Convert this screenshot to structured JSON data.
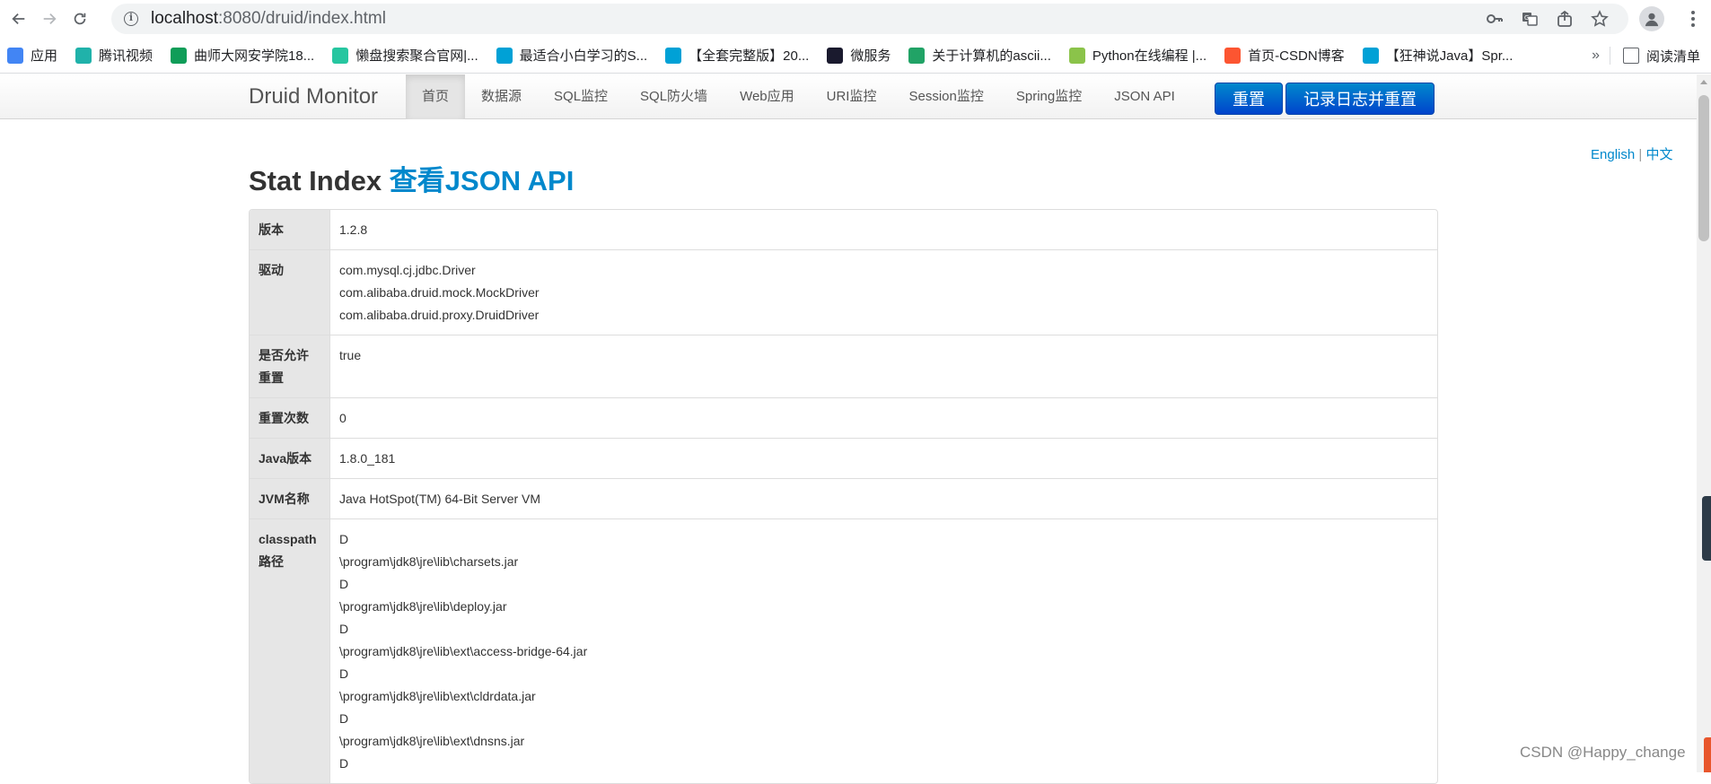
{
  "browser": {
    "url_host": "localhost",
    "url_path": ":8080/druid/index.html"
  },
  "bookmarks": [
    {
      "label": "应用",
      "icon": "apps-grid-icon",
      "color": "#4285f4"
    },
    {
      "label": "腾讯视频",
      "icon": "tencent-video-icon",
      "color": "#20b2aa"
    },
    {
      "label": "曲师大网安学院18...",
      "icon": "sheet-icon",
      "color": "#0f9d58"
    },
    {
      "label": "懒盘搜索聚合官网|...",
      "icon": "gear-green-icon",
      "color": "#26c6a0"
    },
    {
      "label": "最适合小白学习的S...",
      "icon": "bilibili-icon",
      "color": "#00a1d6"
    },
    {
      "label": "【全套完整版】20...",
      "icon": "bilibili-icon",
      "color": "#00a1d6"
    },
    {
      "label": "微服务",
      "icon": "f-letter-icon",
      "color": "#1a1a2e"
    },
    {
      "label": "关于计算机的ascii...",
      "icon": "leaf-icon",
      "color": "#21a366"
    },
    {
      "label": "Python在线编程 |...",
      "icon": "python-icon",
      "color": "#8bc34a"
    },
    {
      "label": "首页-CSDN博客",
      "icon": "csdn-icon",
      "color": "#fc5531"
    },
    {
      "label": "【狂神说Java】Spr...",
      "icon": "bilibili-icon",
      "color": "#00a1d6"
    }
  ],
  "bookmarks_more": "»",
  "reading_list": "阅读清单",
  "druid": {
    "brand": "Druid Monitor",
    "nav": [
      "首页",
      "数据源",
      "SQL监控",
      "SQL防火墙",
      "Web应用",
      "URI监控",
      "Session监控",
      "Spring监控",
      "JSON API"
    ],
    "active_index": 0,
    "reset_button": "重置",
    "log_reset_button": "记录日志并重置"
  },
  "lang": {
    "english": "English",
    "sep": "|",
    "chinese": "中文"
  },
  "title": {
    "main": "Stat Index",
    "link": "查看JSON API"
  },
  "stats": [
    {
      "key": "版本",
      "values": [
        "1.2.8"
      ]
    },
    {
      "key": "驱动",
      "values": [
        "com.mysql.cj.jdbc.Driver",
        "com.alibaba.druid.mock.MockDriver",
        "com.alibaba.druid.proxy.DruidDriver"
      ]
    },
    {
      "key": "是否允许重置",
      "values": [
        "true"
      ]
    },
    {
      "key": "重置次数",
      "values": [
        "0"
      ]
    },
    {
      "key": "Java版本",
      "values": [
        "1.8.0_181"
      ]
    },
    {
      "key": "JVM名称",
      "values": [
        "Java HotSpot(TM) 64-Bit Server VM"
      ]
    },
    {
      "key": "classpath路径",
      "values": [
        "D",
        "\\program\\jdk8\\jre\\lib\\charsets.jar",
        "D",
        "\\program\\jdk8\\jre\\lib\\deploy.jar",
        "D",
        "\\program\\jdk8\\jre\\lib\\ext\\access-bridge-64.jar",
        "D",
        "\\program\\jdk8\\jre\\lib\\ext\\cldrdata.jar",
        "D",
        "\\program\\jdk8\\jre\\lib\\ext\\dnsns.jar",
        "D"
      ]
    }
  ],
  "watermark": "CSDN @Happy_change"
}
